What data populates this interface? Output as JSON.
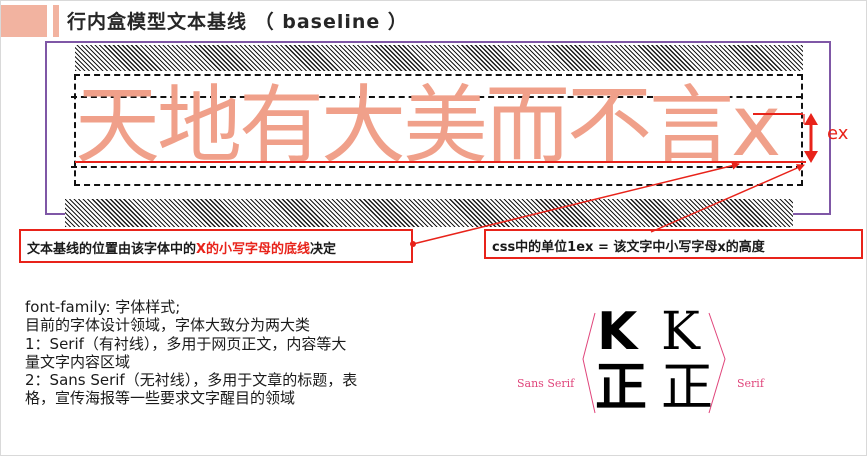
{
  "slide": {
    "title": "行内盒模型文本基线 （ baseline ）"
  },
  "demo": {
    "sample_text": "天地有大美而不言x",
    "ex_label": "ex"
  },
  "annotations": {
    "baseline_prefix": "文本基线的位置由该字体中的",
    "baseline_highlight": "X的小写字母的底线",
    "baseline_suffix": "决定",
    "ex_definition": "css中的单位1ex = 该文字中小写字母x的高度"
  },
  "body": {
    "lines": [
      "font-family:  字体样式;",
      "目前的字体设计领域，字体大致分为两大类",
      "1：Serif（有衬线），多用于网页正文，内容等大",
      "量文字内容区域",
      "2：Sans Serif（无衬线），多用于文章的标题，表",
      "格，宣传海报等一些要求文字醒目的领域"
    ]
  },
  "figure": {
    "sans_label": "Sans Serif",
    "serif_label": "Serif",
    "sans_glyph_top": "K",
    "sans_glyph_bottom": "正",
    "serif_glyph_top": "K",
    "serif_glyph_bottom": "正"
  },
  "colors": {
    "accent_red": "#e8231a",
    "sample_text": "#f0a08a",
    "frame_purple": "#7f57a6",
    "figure_pink": "#e0457b",
    "title_bar": "#f2b3a0"
  }
}
